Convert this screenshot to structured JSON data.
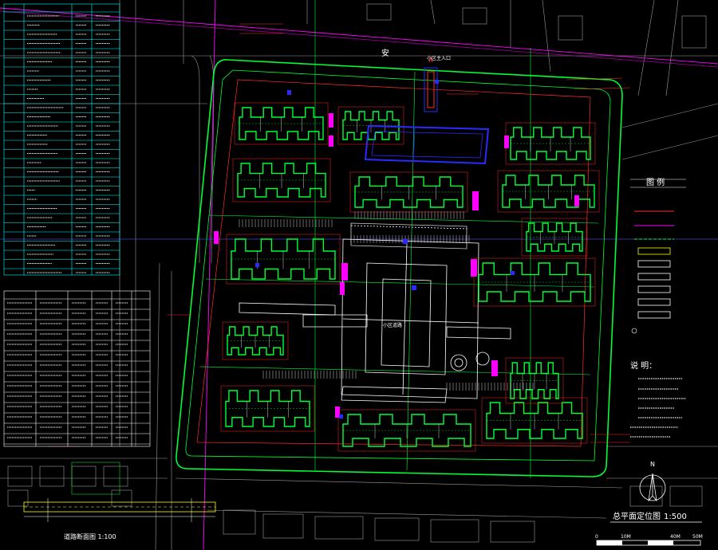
{
  "drawing": {
    "title": "总平面定位图",
    "scale": "1:500",
    "north_letter": "N",
    "scale_bar": [
      "0",
      "10M",
      "40M",
      "50M"
    ],
    "notes_heading": "说 明：",
    "legend_heading": "图 例",
    "road_north": "安",
    "gate_main_label": "小区主入口",
    "ring_road_label": "小区道路",
    "bottom_caption": "道路断面图 1:100"
  },
  "colors": {
    "background": "#000000",
    "building": "#00ff33",
    "red": "#ff2a2a",
    "magenta": "#ff00ff",
    "blue": "#2a2aff",
    "white": "#ffffff",
    "cyan": "#00ffff",
    "yellow": "#ffff00"
  }
}
